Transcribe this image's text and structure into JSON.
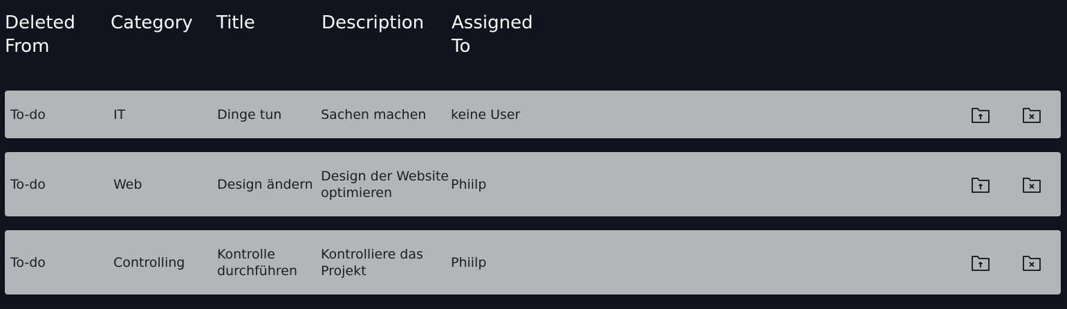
{
  "header": {
    "deleted_from": "Deleted From",
    "category": "Category",
    "title": "Title",
    "description": "Description",
    "assigned_to": "Assigned To"
  },
  "rows": [
    {
      "deleted_from": "To-do",
      "category": "IT",
      "title": "Dinge tun",
      "description": "Sachen machen",
      "assigned_to": "keine User",
      "restore_icon": "folder-restore-icon",
      "delete_icon": "folder-delete-icon"
    },
    {
      "deleted_from": "To-do",
      "category": "Web",
      "title": "Design ändern",
      "description": "Design der Website optimieren",
      "assigned_to": "Phiilp",
      "restore_icon": "folder-restore-icon",
      "delete_icon": "folder-delete-icon"
    },
    {
      "deleted_from": "To-do",
      "category": "Controlling",
      "title": "Kontrolle durchführen",
      "description": "Kontrolliere das Projekt",
      "assigned_to": "Phiilp",
      "restore_icon": "folder-restore-icon",
      "delete_icon": "folder-delete-icon"
    }
  ],
  "colors": {
    "background": "#13131d",
    "row_background": "#b4b5b6",
    "header_text": "#ffffff",
    "row_text": "#1c1c24"
  }
}
